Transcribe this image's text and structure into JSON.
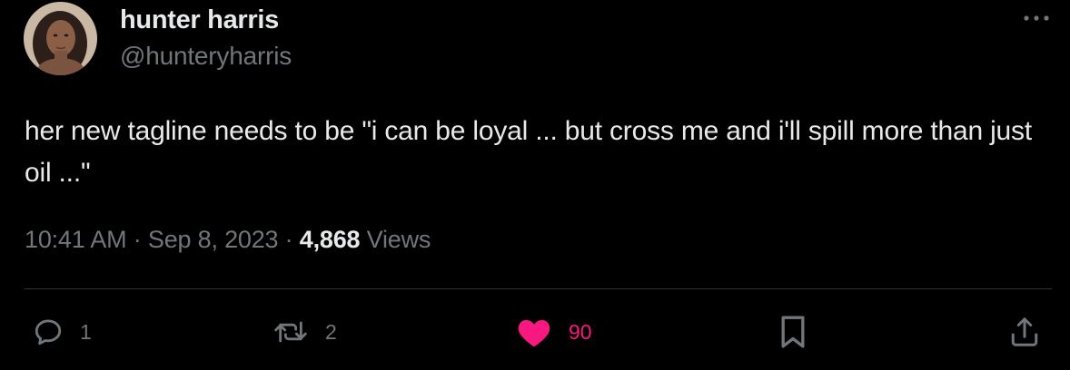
{
  "author": {
    "display_name": "hunter harris",
    "handle": "@hunteryharris",
    "avatar_icon": "avatar-photo"
  },
  "menu": {
    "more_icon": "ellipsis-icon"
  },
  "tweet": {
    "text": "her new tagline needs to be \"i can be loyal ... but cross me and i'll spill more than just oil ...\"",
    "time": "10:41 AM",
    "date": "Sep 8, 2023",
    "separator": "·",
    "views_count": "4,868",
    "views_label": "Views"
  },
  "actions": {
    "reply_count": "1",
    "retweet_count": "2",
    "like_count": "90",
    "like_liked": true
  },
  "colors": {
    "background": "#000000",
    "text_primary": "#e7e9ea",
    "text_secondary": "#71767b",
    "divider": "#2f3336",
    "like_active": "#f91880"
  }
}
